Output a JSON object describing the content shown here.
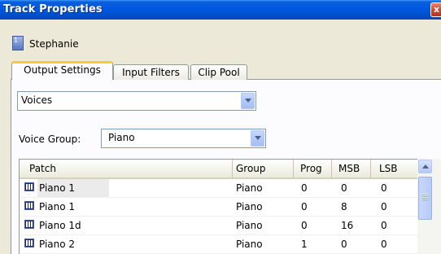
{
  "window": {
    "title": "Track Properties",
    "close_label": "x"
  },
  "track": {
    "number": "1",
    "name": "Stephanie"
  },
  "tabs": [
    {
      "label": "Output Settings",
      "active": true
    },
    {
      "label": "Input Filters",
      "active": false
    },
    {
      "label": "Clip Pool",
      "active": false
    }
  ],
  "output_mode": {
    "value": "Voices"
  },
  "voice_group": {
    "label": "Voice Group:",
    "value": "Piano"
  },
  "table": {
    "columns": [
      "Patch",
      "Group",
      "Prog",
      "MSB",
      "LSB"
    ],
    "rows": [
      {
        "patch": "Piano 1",
        "group": "Piano",
        "prog": "0",
        "msb": "0",
        "lsb": "0",
        "selected": true
      },
      {
        "patch": "Piano 1",
        "group": "Piano",
        "prog": "0",
        "msb": "8",
        "lsb": "0",
        "selected": false
      },
      {
        "patch": "Piano 1d",
        "group": "Piano",
        "prog": "0",
        "msb": "16",
        "lsb": "0",
        "selected": false
      },
      {
        "patch": "Piano 2",
        "group": "Piano",
        "prog": "1",
        "msb": "0",
        "lsb": "0",
        "selected": false
      }
    ]
  },
  "colors": {
    "titlebar": "#0058e0",
    "tab_highlight": "#ffc83c",
    "selection": "#ebebeb"
  },
  "icons": {
    "close": "close-icon",
    "track": "track-icon",
    "patch": "piano-keys-icon",
    "dropdown": "chevron-down-icon",
    "scroll_up": "scroll-up-icon"
  }
}
